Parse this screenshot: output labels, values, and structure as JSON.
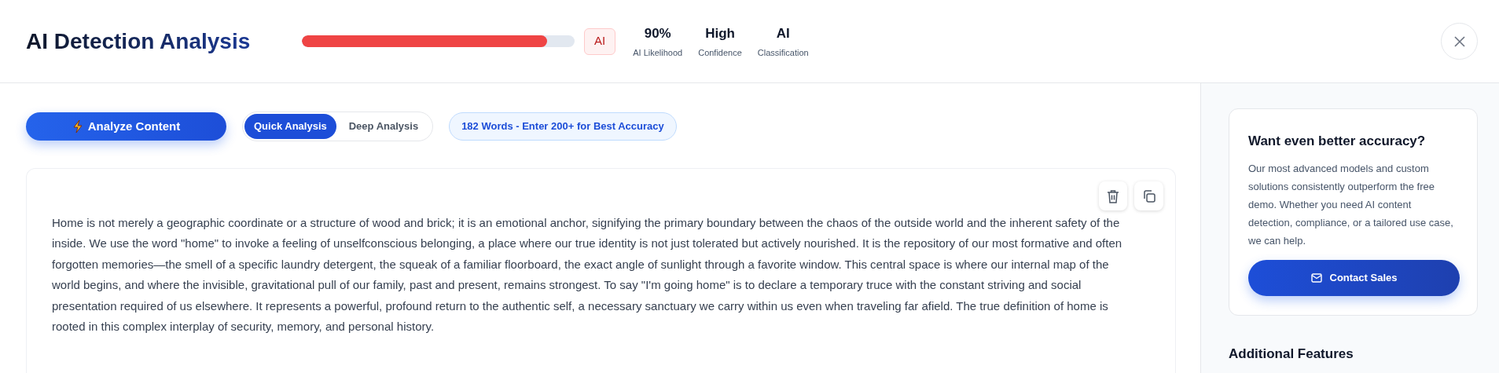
{
  "header": {
    "title": "AI Detection Analysis",
    "meter": {
      "level": 0.9
    },
    "badge": "AI",
    "stats": [
      {
        "value": "90%",
        "label": "AI Likelihood"
      },
      {
        "value": "High",
        "label": "Confidence"
      },
      {
        "value": "AI",
        "label": "Classification"
      }
    ]
  },
  "toolbar": {
    "analyze_button": "Analyze Content",
    "modes": [
      {
        "label": "Quick Analysis",
        "selected": true
      },
      {
        "label": "Deep Analysis",
        "selected": false
      }
    ],
    "word_count": "182 Words - Enter 200+ for Best Accuracy"
  },
  "editor": {
    "text": "Home is not merely a geographic coordinate or a structure of wood and brick; it is an emotional anchor, signifying the primary boundary between the chaos of the outside world and the inherent safety of the inside. We use the word \"home\" to invoke a feeling of unselfconscious belonging, a place where our true identity is not just tolerated but actively nourished. It is the repository of our most formative and often forgotten memories—the smell of a specific laundry detergent, the squeak of a familiar floorboard, the exact angle of sunlight through a favorite window. This central space is where our internal map of the world begins, and where the invisible, gravitational pull of our family, past and present, remains strongest. To say \"I'm going home\" is to declare a temporary truce with the constant striving and social presentation required of us elsewhere. It represents a powerful, profound return to the authentic self, a necessary sanctuary we carry within us even when traveling far afield. The true definition of home is rooted in this complex interplay of security, memory, and personal history."
  },
  "sidebar": {
    "promo": {
      "title": "Want even better accuracy?",
      "body": "Our most advanced models and custom solutions consistently outperform the free demo. Whether you need AI content detection, compliance, or a tailored use case, we can help.",
      "button": "Contact Sales"
    },
    "section_title": "Additional Features"
  }
}
